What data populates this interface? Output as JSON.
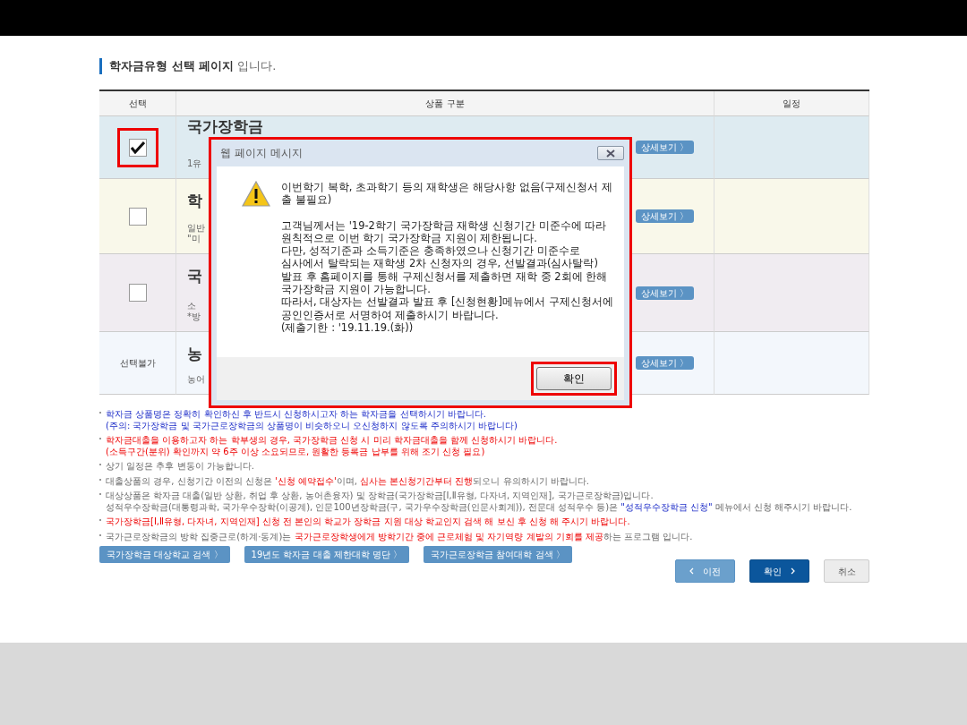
{
  "page_title": {
    "bold": "학자금유형 선택 페이지",
    "rest": "입니다."
  },
  "table": {
    "columns": [
      "선택",
      "상품 구분",
      "일정"
    ],
    "rows": [
      {
        "kind": "checkbox",
        "checked": true,
        "highlighted": true,
        "color": "#deebf1",
        "title": "국가장학금",
        "lines": [
          "1유"
        ],
        "detail": "상세보기 〉"
      },
      {
        "kind": "checkbox",
        "checked": false,
        "highlighted": false,
        "color": "#f9f8ea",
        "title": "학",
        "lines": [
          "일반",
          "\"미"
        ],
        "detail": "상세보기 〉"
      },
      {
        "kind": "checkbox",
        "checked": false,
        "highlighted": false,
        "color": "#f0ecf1",
        "title": "국",
        "lines": [
          "소",
          "*방"
        ],
        "detail": "상세보기 〉"
      },
      {
        "kind": "unavailable",
        "label": "선택불가",
        "color": "#f3f7fc",
        "title": "농",
        "lines": [
          "농어"
        ],
        "detail": "상세보기 〉"
      }
    ]
  },
  "notes": [
    {
      "lines": [
        [
          {
            "kind": "info",
            "text": "학자금 상품명은 정확히 확인하신 후 반드시 신청하시고자 하는 학자금을 선택하시기 바랍니다."
          }
        ],
        [
          {
            "kind": "info",
            "text": "(주의: 국가장학금 및 국가근로장학금의 상품명이 비슷하오니 오신청하지 않도록 주의하시기 바랍니다)"
          }
        ]
      ]
    },
    {
      "lines": [
        [
          {
            "kind": "alert",
            "text": "학자금대출을 이용하고자 하는 학부생의 경우, 국가장학금 신청 시 미리 학자금대출을 함께 신청하시기 바랍니다."
          }
        ],
        [
          {
            "kind": "alert",
            "text": "(소득구간(분위) 확인까지 약 6주 이상 소요되므로, 원활한 등록금 납부를 위해 조기 신청 필요)"
          }
        ]
      ]
    },
    {
      "lines": [
        [
          {
            "kind": "plain",
            "text": "상기 일정은 추후 변동이 가능합니다."
          }
        ]
      ]
    },
    {
      "lines": [
        [
          {
            "kind": "plain",
            "text": "대출상품의 경우, 신청기간 이전의 신청은 "
          },
          {
            "kind": "alert",
            "text": "'신청 예약접수'"
          },
          {
            "kind": "plain",
            "text": "이며, "
          },
          {
            "kind": "alert",
            "text": "심사는 본신청기간부터 진행"
          },
          {
            "kind": "plain",
            "text": "되오니 유의하시기 바랍니다."
          }
        ]
      ]
    },
    {
      "lines": [
        [
          {
            "kind": "plain",
            "text": "대상상품은 학자금 대출(일반 상환, 취업 후 상환, 농어촌융자) 및 장학금(국가장학금[Ⅰ,Ⅱ유형, 다자녀, 지역인재], 국가근로장학금)입니다."
          }
        ],
        [
          {
            "kind": "plain",
            "text": "성적우수장학금(대통령과학, 국가우수장학(이공계), 인문100년장학금(구, 국가우수장학금(인문사회계)), 전문대 성적우수 등)은 "
          },
          {
            "kind": "info",
            "text": "\"성적우수장학금 신청\""
          },
          {
            "kind": "plain",
            "text": " 메뉴에서 신청 해주시기 바랍니다."
          }
        ]
      ]
    },
    {
      "lines": [
        [
          {
            "kind": "alert",
            "text": "국가장학금[Ⅰ,Ⅱ유형, 다자녀, 지역인재] 신청 전 본인의 학교가 장학금 지원 대상 학교인지 검색 해 보신 후 신청 해 주시기 바랍니다."
          }
        ]
      ]
    },
    {
      "lines": [
        [
          {
            "kind": "plain",
            "text": "국가근로장학금의 방학 집중근로(하계·동계)는 "
          },
          {
            "kind": "alert",
            "text": "국가근로장학생에게 방학기간 중에 근로체험 및 자기역량 계발의 기회를 제공"
          },
          {
            "kind": "plain",
            "text": "하는 프로그램 입니다."
          }
        ]
      ]
    }
  ],
  "link_buttons": [
    "국가장학금 대상학교 검색 〉",
    "19년도 학자금 대출 제한대학 명단 〉",
    "국가근로장학금 참여대학 검색 〉"
  ],
  "nav_buttons": [
    {
      "kind": "prev",
      "label": "이전"
    },
    {
      "kind": "next",
      "label": "확인"
    },
    {
      "kind": "cancel",
      "label": "취소"
    }
  ],
  "dialog": {
    "title": "웹 페이지 메시지",
    "highlighted": true,
    "paragraphs": [
      [
        "이번학기 복학, 초과학기 등의 재학생은 해당사항 없음(구제신청서 제",
        "출 불필요)"
      ],
      [
        "고객님께서는 '19-2학기 국가장학금 재학생 신청기간 미준수에 따라",
        "원칙적으로 이번 학기 국가장학금 지원이 제한됩니다.",
        "다만, 성적기준과 소득기준은 충족하였으나 신청기간 미준수로",
        "심사에서 탈락되는 재학생 2차 신청자의 경우, 선발결과(심사탈락)",
        "발표 후 홈페이지를 통해 구제신청서를 제출하면 재학 중 2회에 한해",
        "국가장학금 지원이 가능합니다.",
        "따라서, 대상자는 선발결과 발표 후 [신청현황]메뉴에서 구제신청서에",
        "공인인증서로 서명하여 제출하시기 바랍니다.",
        "(제출기한 : '19.11.19.(화))"
      ]
    ],
    "ok_button": {
      "label": "확인",
      "highlighted": true
    }
  }
}
